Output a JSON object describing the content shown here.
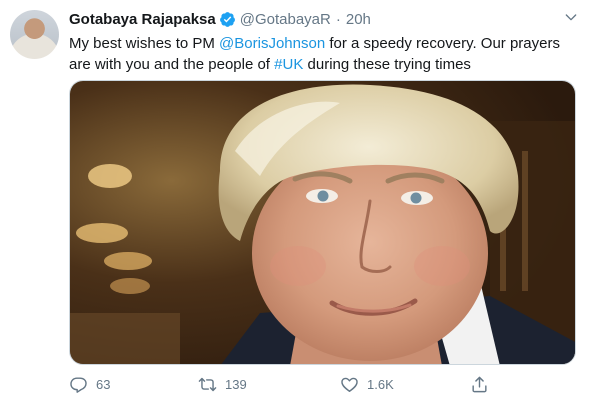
{
  "tweet": {
    "author_name": "Gotabaya Rajapaksa",
    "handle": "@GotabayaR",
    "separator": "·",
    "timestamp": "20h",
    "text_part1": "My best wishes to PM ",
    "mention": "@BorisJohnson",
    "text_part2": " for a speedy recovery. Our prayers are with you and the people of ",
    "hashtag": "#UK",
    "text_part3": " during these trying times"
  },
  "actions": {
    "reply_count": "63",
    "retweet_count": "139",
    "like_count": "1.6K"
  },
  "icons": {
    "avatar": "avatar",
    "verified": "verified-badge-icon",
    "menu": "chevron-down-icon",
    "reply": "reply-icon",
    "retweet": "retweet-icon",
    "like": "heart-icon",
    "share": "share-icon"
  },
  "colors": {
    "link": "#1b95e0",
    "secondary_text": "#657786",
    "verified": "#1da1f2"
  }
}
